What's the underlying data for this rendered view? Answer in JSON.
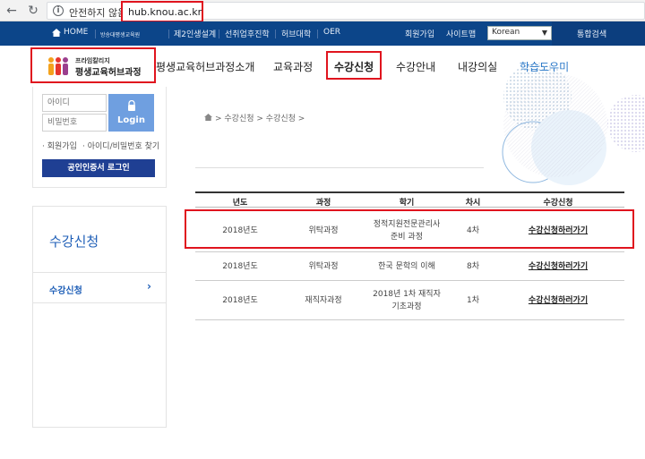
{
  "browser": {
    "insecure_label": "안전하지 않음",
    "url": "hub.knou.ac.kr"
  },
  "topbar": {
    "home": "HOME",
    "items": [
      "방송대평생교육원",
      "제2인생설계",
      "선취업후진학",
      "허브대학",
      "OER"
    ],
    "join": "회원가입",
    "sitemap": "사이트맵",
    "language": "Korean",
    "total_search": "통합검색"
  },
  "logo": {
    "line1": "프라임칼리지",
    "line2": "평생교육허브과정"
  },
  "nav": {
    "items": [
      "평생교육허브과정소개",
      "교육과정",
      "수강신청",
      "수강안내",
      "내강의실",
      "학습도우미"
    ]
  },
  "login": {
    "id_placeholder": "아이디",
    "pw_placeholder": "비밀번호",
    "button": "Login",
    "join_link": "회원가입",
    "find_link": "아이디/비밀번호 찾기",
    "cert_login": "공인인증서 로그인"
  },
  "sidebar": {
    "title": "수강신청",
    "item": "수강신청"
  },
  "breadcrumb": {
    "text": "> 수강신청 > 수강신청 >"
  },
  "table": {
    "headers": [
      "년도",
      "과정",
      "학기",
      "차시",
      "수강신청"
    ],
    "rows": [
      {
        "year": "2018년도",
        "course": "위탁과정",
        "semester_l1": "정적지원전문관리사",
        "semester_l2": "준비 과정",
        "session": "4차",
        "apply": "수강신청하러가기"
      },
      {
        "year": "2018년도",
        "course": "위탁과정",
        "semester_l1": "한국 문학의 이해",
        "semester_l2": "",
        "session": "8차",
        "apply": "수강신청하러가기"
      },
      {
        "year": "2018년도",
        "course": "재직자과정",
        "semester_l1": "2018년 1차 재직자",
        "semester_l2": "기초과정",
        "session": "1차",
        "apply": "수강신청하러가기"
      }
    ]
  },
  "colors": {
    "topbar": "#0c4589",
    "highlight": "#e0141e",
    "accent": "#1f5fb7"
  }
}
